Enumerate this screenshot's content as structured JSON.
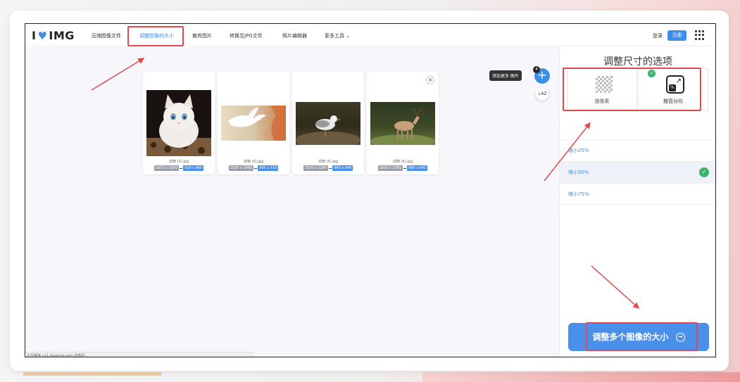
{
  "nav": {
    "logo_left": "I",
    "logo_right": "IMG",
    "items": [
      "压缩图像文件",
      "调整图像的大小",
      "裁剪图片",
      "转换至JPG文件",
      "照片编辑器",
      "更多工具"
    ],
    "login": "登录",
    "register": "注册"
  },
  "images": [
    {
      "name": "动物 (3).jpg",
      "old": "1837 x 1920",
      "new": "919 x 960"
    },
    {
      "name": "动物 (4).jpg",
      "old": "1920 x 1065",
      "new": "960 x 533"
    },
    {
      "name": "动物 (5).jpg",
      "old": "1920 x 1280",
      "new": "960 x 640"
    },
    {
      "name": "动物 (6).jpg",
      "old": "1920 x 1281",
      "new": "960 x 641"
    }
  ],
  "workspace": {
    "tooltip": "添加更多 图片",
    "badge": "4",
    "sort_label": "↓AZ",
    "status": "正在等待 cn1.iloveimg.com 的响应..."
  },
  "panel": {
    "title": "调整尺寸的选项",
    "option_pixel": "按像素",
    "option_percent": "按百分比",
    "percent_symbol": "%",
    "rows": [
      "缩小25%",
      "缩小50%",
      "缩小75%"
    ],
    "cta": "调整多个图像的大小"
  },
  "colors": {
    "accent": "#3d8eea",
    "annotation": "#e2484e",
    "check": "#3db26f"
  }
}
